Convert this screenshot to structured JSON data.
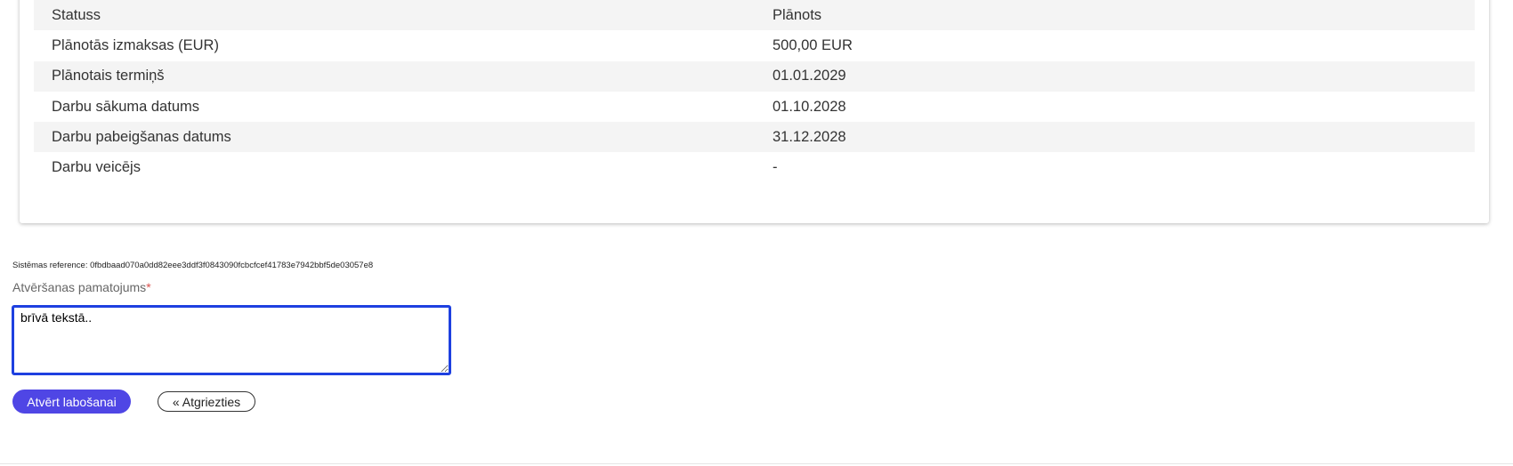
{
  "details": {
    "rows": [
      {
        "label": "Statuss",
        "value": "Plānots"
      },
      {
        "label": "Plānotās izmaksas (EUR)",
        "value": "500,00 EUR"
      },
      {
        "label": "Plānotais termiņš",
        "value": "01.01.2029"
      },
      {
        "label": "Darbu sākuma datums",
        "value": "01.10.2028"
      },
      {
        "label": "Darbu pabeigšanas datums",
        "value": "31.12.2028"
      },
      {
        "label": "Darbu veicējs",
        "value": "-"
      }
    ]
  },
  "system_reference": "Sistēmas reference: 0fbdbaad070a0dd82eee3ddf3f0843090fcbcfcef41783e7942bbf5de03057e8",
  "form": {
    "field_label": "Atvēršanas pamatojums",
    "required_mark": "*",
    "reason_value": "brīvā tekstā.."
  },
  "actions": {
    "submit_label": "Atvērt labošanai",
    "back_label": "« Atgriezties"
  },
  "colors": {
    "primary": "#4f46e5",
    "focus_border": "#1e40e0",
    "row_stripe": "#f4f4f4",
    "required": "#d9534f"
  }
}
